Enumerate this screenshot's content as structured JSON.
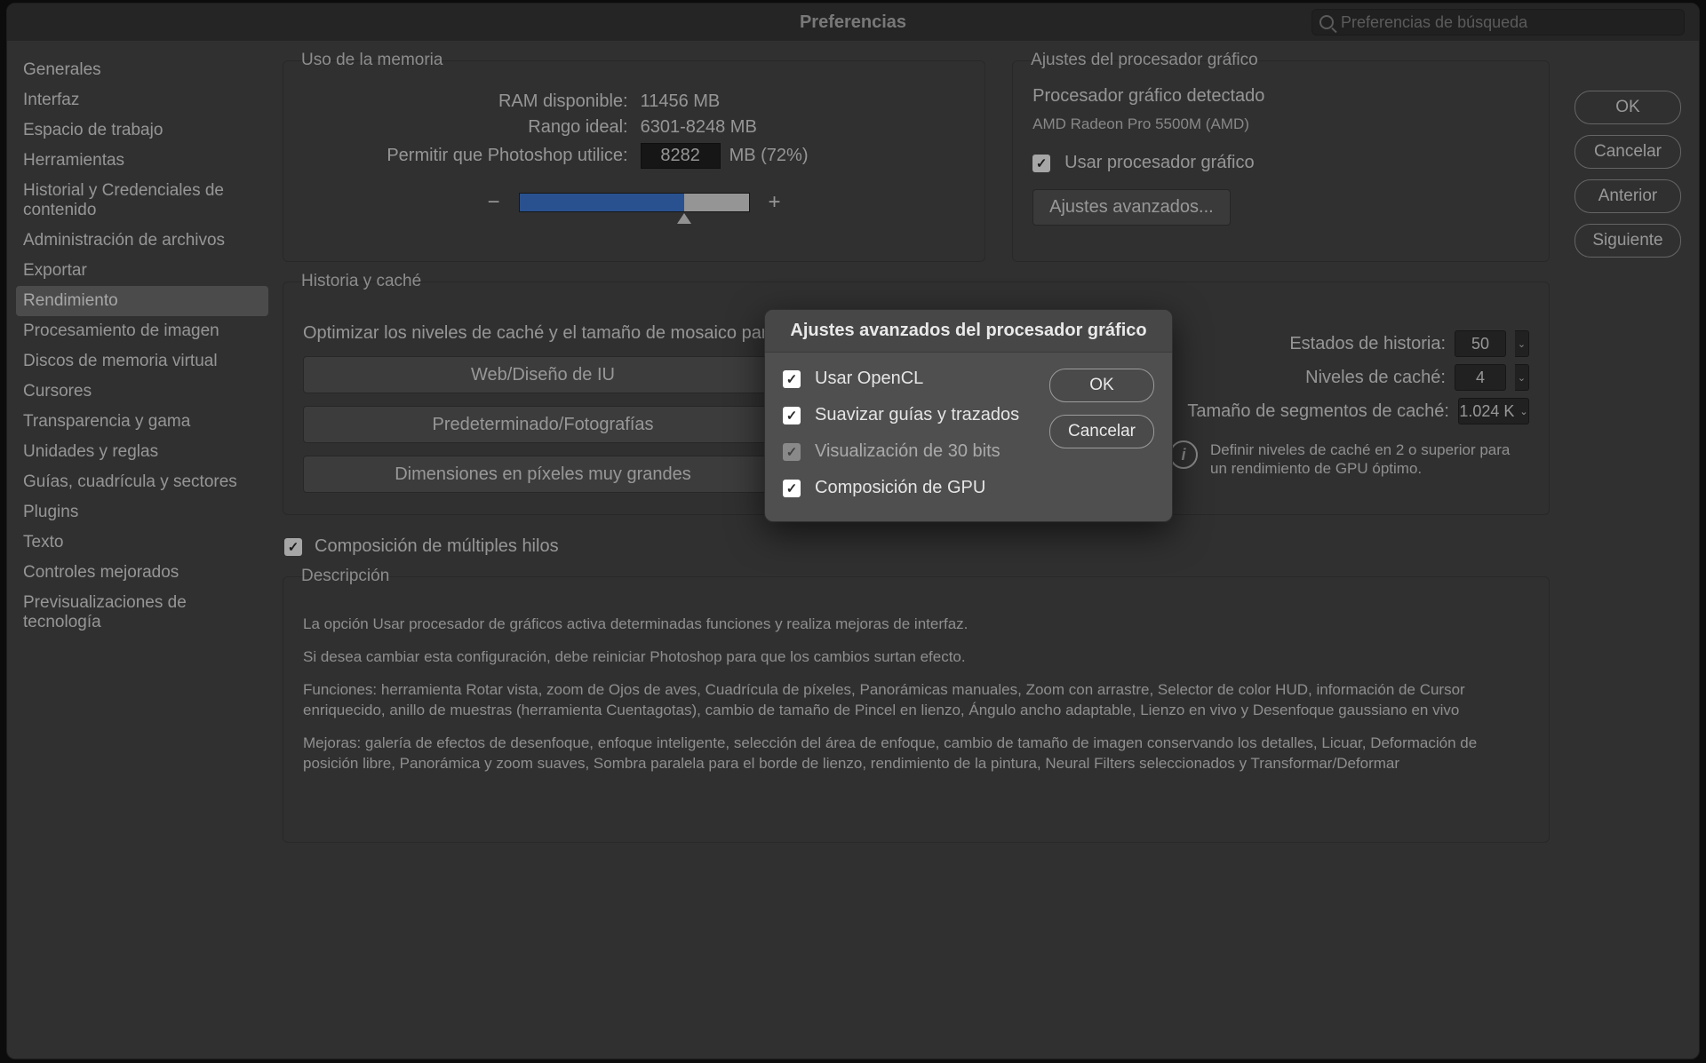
{
  "title": "Preferencias",
  "search": {
    "placeholder": "Preferencias de búsqueda"
  },
  "actions": {
    "ok": "OK",
    "cancel": "Cancelar",
    "prev": "Anterior",
    "next": "Siguiente"
  },
  "sidebar": {
    "items": [
      "Generales",
      "Interfaz",
      "Espacio de trabajo",
      "Herramientas",
      "Historial y Credenciales de contenido",
      "Administración de archivos",
      "Exportar",
      "Rendimiento",
      "Procesamiento de imagen",
      "Discos de memoria virtual",
      "Cursores",
      "Transparencia y gama",
      "Unidades y reglas",
      "Guías, cuadrícula y sectores",
      "Plugins",
      "Texto",
      "Controles mejorados",
      "Previsualizaciones de tecnología"
    ],
    "selected_index": 7
  },
  "memory": {
    "legend": "Uso de la memoria",
    "available_label": "RAM disponible:",
    "available_value": "11456 MB",
    "ideal_label": "Rango ideal:",
    "ideal_value": "6301-8248 MB",
    "allow_label": "Permitir que Photoshop utilice:",
    "allow_value": "8282",
    "allow_suffix": "MB (72%)",
    "minus": "−",
    "plus": "+"
  },
  "gpu": {
    "legend": "Ajustes del procesador gráfico",
    "detected_label": "Procesador gráfico detectado",
    "detected_value": "AMD Radeon Pro 5500M (AMD)",
    "use_gpu_label": "Usar procesador gráfico",
    "advanced_btn": "Ajustes avanzados..."
  },
  "history": {
    "legend": "Historia y caché",
    "optimize_label": "Optimizar los niveles de caché y el tamaño de mosaico para:",
    "btn_web": "Web/Diseño de IU",
    "btn_default": "Predeterminado/Fotografías",
    "btn_large": "Dimensiones en píxeles muy grandes",
    "history_states_label": "Estados de historia:",
    "history_states_value": "50",
    "cache_levels_label": "Niveles de caché:",
    "cache_levels_value": "4",
    "tile_size_label": "Tamaño de segmentos de caché:",
    "tile_size_value": "1.024 K",
    "info_text": "Definir niveles de caché en 2 o superior para un rendimiento de GPU óptimo."
  },
  "multithread_label": "Composición de múltiples hilos",
  "description": {
    "legend": "Descripción",
    "p1": "La opción Usar procesador de gráficos activa determinadas funciones y realiza mejoras de interfaz.",
    "p2": "Si desea cambiar esta configuración, debe reiniciar Photoshop para que los cambios surtan efecto.",
    "p3": "Funciones: herramienta Rotar vista, zoom de Ojos de aves, Cuadrícula de píxeles, Panorámicas manuales, Zoom con arrastre, Selector de color HUD, información de Cursor enriquecido, anillo de muestras (herramienta Cuentagotas), cambio de tamaño de Pincel en lienzo, Ángulo ancho adaptable, Lienzo en vivo y Desenfoque gaussiano en vivo",
    "p4": "Mejoras: galería de efectos de desenfoque, enfoque inteligente, selección del área de enfoque, cambio de tamaño de imagen conservando los detalles, Licuar, Deformación de posición libre, Panorámica y zoom suaves, Sombra paralela para el borde de lienzo, rendimiento de la pintura, Neural Filters seleccionados y Transformar/Deformar"
  },
  "modal": {
    "title": "Ajustes avanzados del procesador gráfico",
    "opts": {
      "opencl": "Usar OpenCL",
      "smooth": "Suavizar guías y trazados",
      "bit30": "Visualización de 30 bits",
      "gpucomp": "Composición de GPU"
    },
    "ok": "OK",
    "cancel": "Cancelar"
  }
}
